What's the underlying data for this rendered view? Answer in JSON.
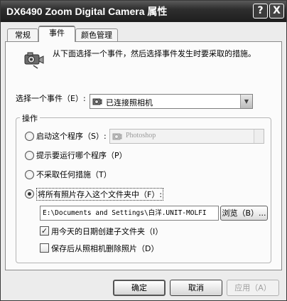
{
  "window": {
    "title": "DX6490 Zoom Digital Camera 属性",
    "help_glyph": "?",
    "close_glyph": "X"
  },
  "tabs": [
    {
      "label": "常规",
      "selected": false
    },
    {
      "label": "事件",
      "selected": true
    },
    {
      "label": "颜色管理",
      "selected": false
    }
  ],
  "intro": {
    "icon": "camera-icon",
    "text": "从下面选择一个事件，然后选择事件发生时要采取的措施。"
  },
  "event_select": {
    "label": "选择一个事件（E）:",
    "value": "已连接照相机",
    "icon": "camera-small-icon"
  },
  "actions": {
    "group_title": "操作",
    "options": [
      {
        "label": "启动这个程序（S）:",
        "selected": false
      },
      {
        "label": "提示要运行哪个程序（P）",
        "selected": false
      },
      {
        "label": "不采取任何措施（T）",
        "selected": false
      },
      {
        "label": "将所有照片存入这个文件夹中（F）:",
        "selected": true
      }
    ],
    "program_value": "Photoshop",
    "folder_path": "E:\\Documents and Settings\\白洋.UNIT-MOLFI",
    "browse_label": "浏览（B）..."
  },
  "checkboxes": [
    {
      "label": "用今天的日期创建子文件夹（I）",
      "checked": true
    },
    {
      "label": "保存后从照相机删除照片（D）",
      "checked": false
    }
  ],
  "buttons": {
    "ok": "确定",
    "cancel": "取消",
    "apply": "应用（A）"
  }
}
